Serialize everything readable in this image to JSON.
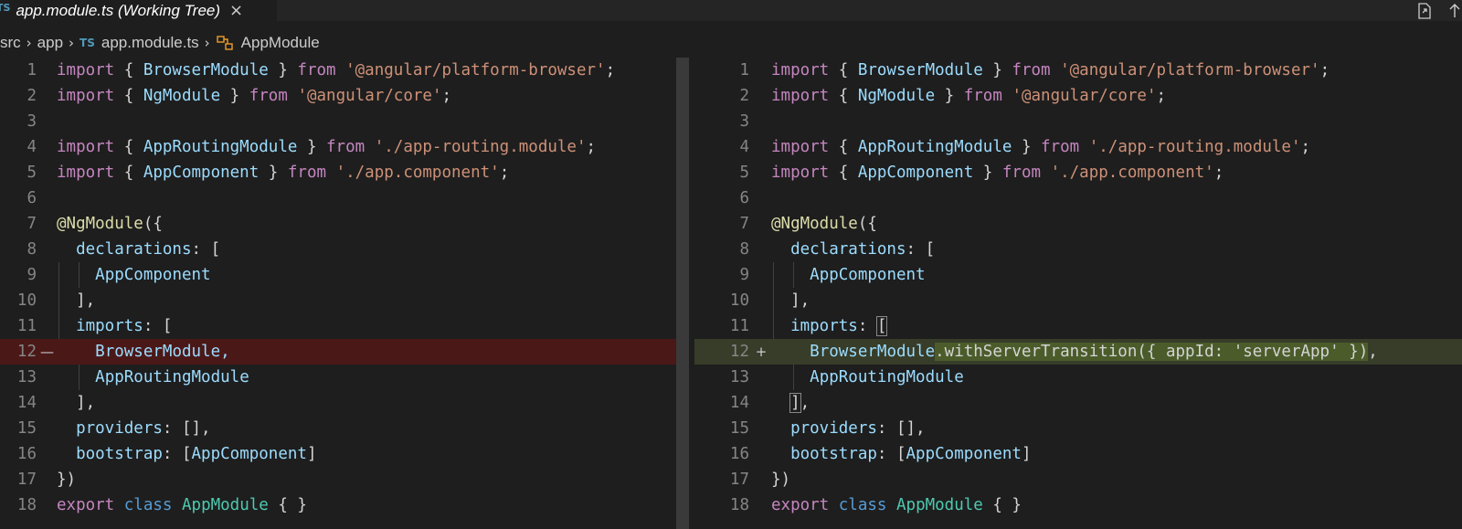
{
  "tab": {
    "lang_badge": "TS",
    "title": "app.module.ts (Working Tree)",
    "close_glyph": "×",
    "actions": [
      "open-file-icon",
      "arrow-up-icon"
    ]
  },
  "breadcrumb": {
    "items": [
      "src",
      "app",
      "app.module.ts",
      "AppModule"
    ],
    "lang_badge": "TS",
    "symbol_icon": "class-icon"
  },
  "diff": {
    "removed_marker": "—",
    "added_marker": "+",
    "left_numbers": [
      "1",
      "2",
      "3",
      "4",
      "5",
      "6",
      "7",
      "8",
      "9",
      "10",
      "11",
      "12",
      "13",
      "14",
      "15",
      "16",
      "17",
      "18"
    ],
    "right_numbers": [
      "1",
      "2",
      "3",
      "4",
      "5",
      "6",
      "7",
      "8",
      "9",
      "10",
      "11",
      "12",
      "13",
      "14",
      "15",
      "16",
      "17",
      "18"
    ],
    "left_line12": "BrowserModule,",
    "right_line12_head": "BrowserModule",
    "right_line12_added": ".withServerTransition({ appId: 'serverApp' })",
    "right_line12_tail": ","
  },
  "colors": {
    "editor_bg": "#1e1e1e",
    "removed_bg": "#4b1818",
    "added_bg": "#373d29",
    "keyword": "#c586c0",
    "string": "#ce9178",
    "type": "#4ec9b0",
    "variable": "#9cdcfe"
  }
}
